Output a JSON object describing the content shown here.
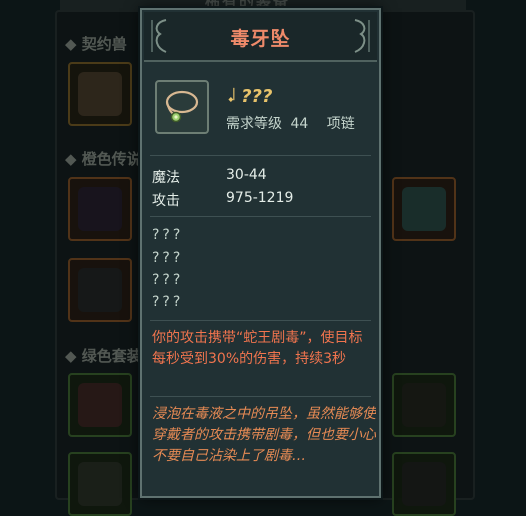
{
  "background": {
    "panel_title": "稀有的装备",
    "sections": [
      {
        "label": "◆ 契约兽"
      },
      {
        "label": "◆ 橙色传说"
      },
      {
        "label": "◆ 绿色套装"
      }
    ]
  },
  "tooltip": {
    "title": "毒牙坠",
    "item_name": "???",
    "item_icon": "necklace-icon",
    "requirement_label": "需求等级",
    "requirement_level": "44",
    "item_type": "项链",
    "stats": [
      {
        "label": "魔法",
        "value": "30-44"
      },
      {
        "label": "攻击",
        "value": "975-1219"
      }
    ],
    "unknown_attributes": [
      "???",
      "???",
      "???",
      "???"
    ],
    "effect_text": "你的攻击携带“蛇王剧毒”，使目标每秒受到30%的伤害，持续3秒",
    "flavor_text": "浸泡在毒液之中的吊坠，虽然能够使穿戴者的攻击携带剧毒，但也要小心不要自己沾染上了剧毒…"
  },
  "colors": {
    "title": "#ee8a6a",
    "item_name": "#e8c36b",
    "effect": "#f0744e",
    "flavor": "#e68a54"
  }
}
